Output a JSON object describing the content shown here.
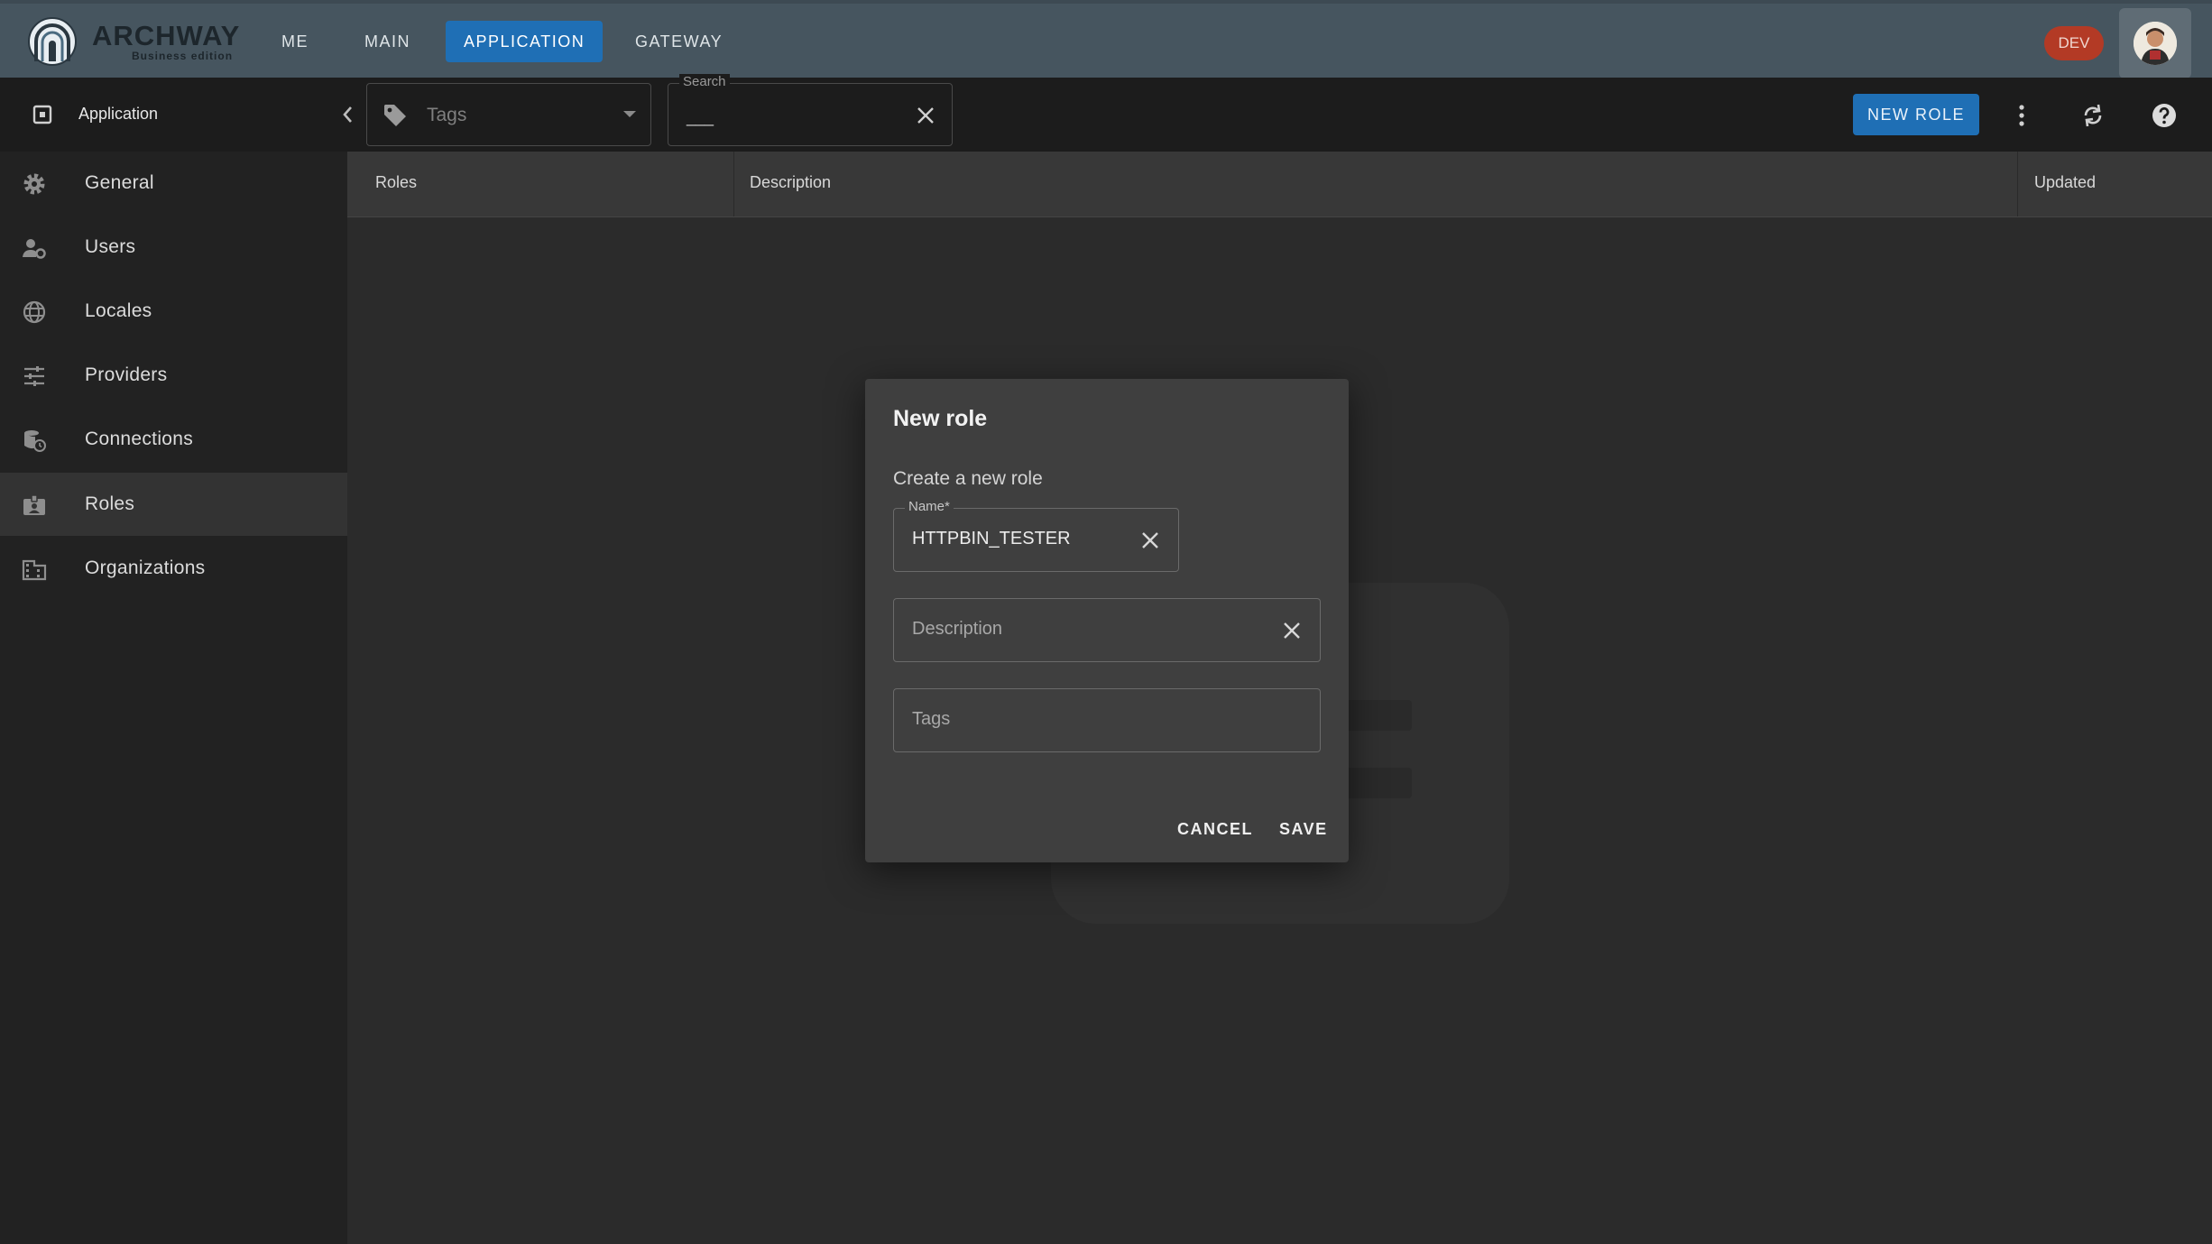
{
  "header": {
    "brand_name": "ARCHWAY",
    "brand_sub": "Business edition",
    "tabs": [
      {
        "label": "ME"
      },
      {
        "label": "MAIN"
      },
      {
        "label": "APPLICATION"
      },
      {
        "label": "GATEWAY"
      }
    ],
    "active_tab": "APPLICATION",
    "env_badge": "DEV"
  },
  "toolbar": {
    "section_title": "Application",
    "tags_placeholder": "Tags",
    "search_label": "Search",
    "search_value": "___",
    "new_role_label": "NEW ROLE"
  },
  "sidebar": {
    "items": [
      {
        "label": "General",
        "icon": "gear-icon"
      },
      {
        "label": "Users",
        "icon": "users-gear-icon"
      },
      {
        "label": "Locales",
        "icon": "globe-icon"
      },
      {
        "label": "Providers",
        "icon": "sliders-icon"
      },
      {
        "label": "Connections",
        "icon": "database-clock-icon"
      },
      {
        "label": "Roles",
        "icon": "badge-icon"
      },
      {
        "label": "Organizations",
        "icon": "building-icon"
      }
    ],
    "active": "Roles"
  },
  "table": {
    "columns": [
      "Roles",
      "Description",
      "Updated"
    ]
  },
  "dialog": {
    "title": "New role",
    "subtitle": "Create a new role",
    "name_label": "Name*",
    "name_value": "HTTPBIN_TESTER",
    "description_placeholder": "Description",
    "tags_placeholder": "Tags",
    "cancel_label": "CANCEL",
    "save_label": "SAVE"
  },
  "colors": {
    "appbar": "#46555f",
    "accent": "#1f6fb5",
    "env_badge": "#b33a25",
    "background": "#2b2b2b"
  }
}
